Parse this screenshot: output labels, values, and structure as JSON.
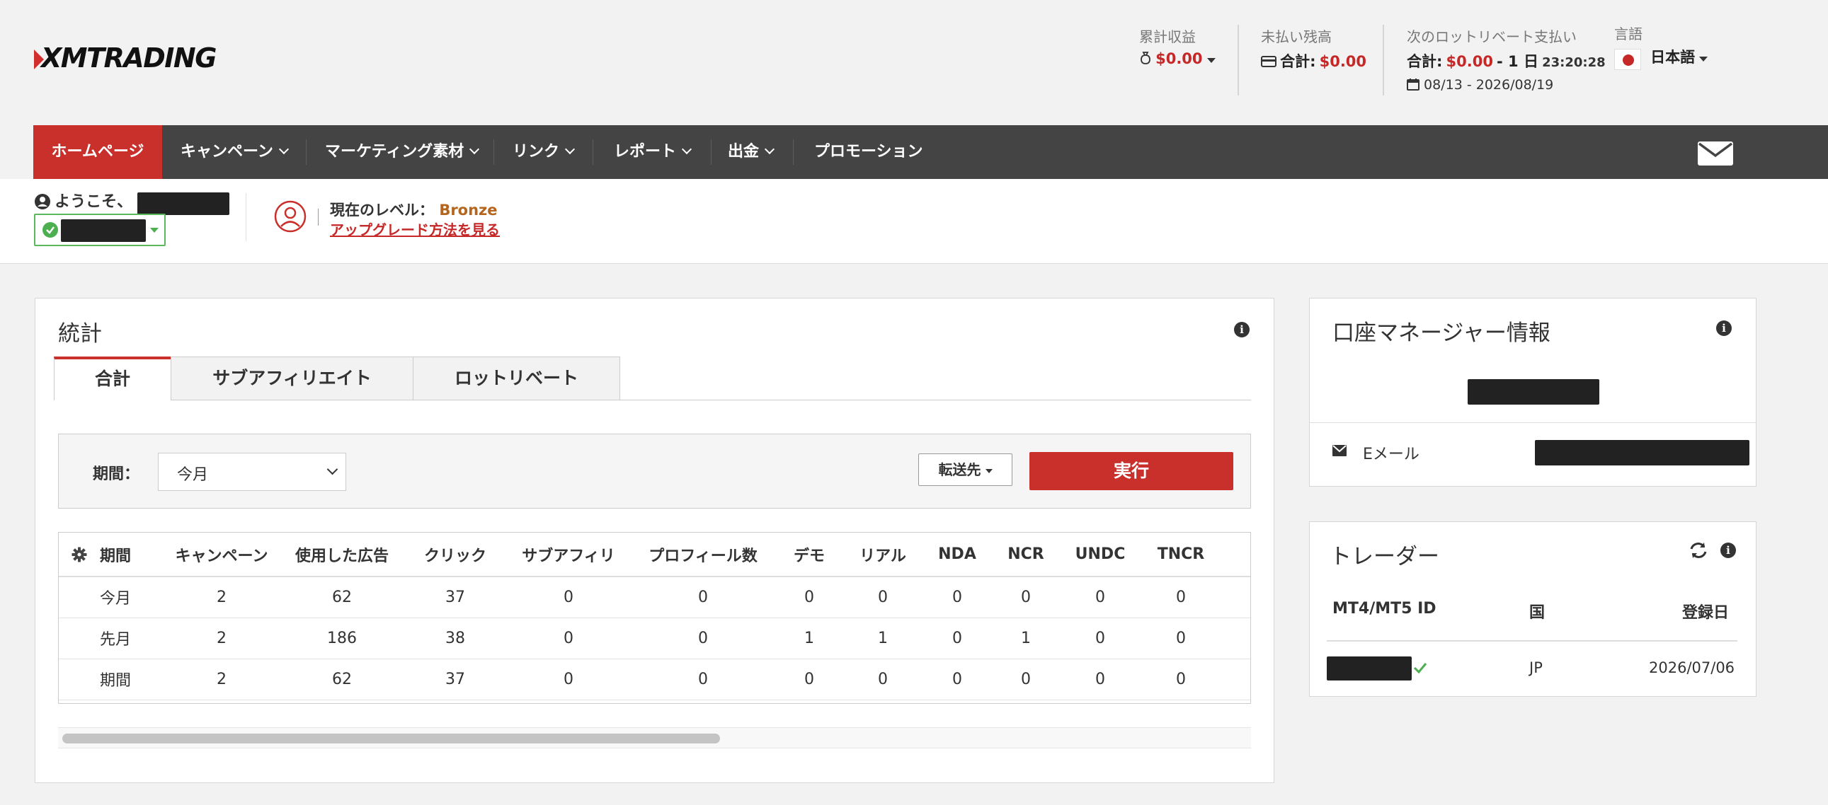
{
  "brand": {
    "logo": "XMTRADING"
  },
  "header": {
    "cumulative": {
      "label": "累計収益",
      "value": "$0.00"
    },
    "unpaid": {
      "label": "未払い残高",
      "total_label": "合計:",
      "value": "$0.00"
    },
    "next_payment": {
      "label": "次のロットリベート支払い",
      "total_label": "合計:",
      "value": "$0.00",
      "countdown_days": "- 1 日",
      "countdown_time": "23:20:28",
      "date_range": "08/13 - 2026/08/19"
    },
    "language": {
      "label": "言語",
      "value": "日本語"
    }
  },
  "nav": {
    "items": [
      {
        "label": "ホームページ",
        "dropdown": false
      },
      {
        "label": "キャンペーン",
        "dropdown": true
      },
      {
        "label": "マーケティング素材",
        "dropdown": true
      },
      {
        "label": "リンク",
        "dropdown": true
      },
      {
        "label": "レポート",
        "dropdown": true
      },
      {
        "label": "出金",
        "dropdown": true
      },
      {
        "label": "プロモーション",
        "dropdown": false
      }
    ]
  },
  "welcome": {
    "greeting": "ようこそ、",
    "level_label": "現在のレベル：",
    "level_value": "Bronze",
    "upgrade_link": "アップグレード方法を見る"
  },
  "stats": {
    "title": "統計",
    "tabs": [
      "合計",
      "サブアフィリエイト",
      "ロットリベート"
    ],
    "filter": {
      "period_label": "期間：",
      "period_value": "今月",
      "forward_label": "転送先",
      "execute_label": "実行"
    },
    "columns": [
      "期間",
      "キャンペーン",
      "使用した広告",
      "クリック",
      "サブアフィリ",
      "プロフィール数",
      "デモ",
      "リアル",
      "NDA",
      "NCR",
      "UNDC",
      "TNCR"
    ],
    "rows": [
      [
        "今月",
        "2",
        "62",
        "37",
        "0",
        "0",
        "0",
        "0",
        "0",
        "0",
        "0",
        "0"
      ],
      [
        "先月",
        "2",
        "186",
        "38",
        "0",
        "0",
        "1",
        "1",
        "0",
        "1",
        "0",
        "0"
      ],
      [
        "期間",
        "2",
        "62",
        "37",
        "0",
        "0",
        "0",
        "0",
        "0",
        "0",
        "0",
        "0"
      ]
    ]
  },
  "manager": {
    "title": "口座マネージャー情報",
    "email_label": "Eメール"
  },
  "traders": {
    "title": "トレーダー",
    "columns": [
      "MT4/MT5 ID",
      "国",
      "登録日"
    ],
    "rows": [
      {
        "country": "JP",
        "date": "2026/07/06"
      }
    ]
  },
  "colors": {
    "accent": "#c9302c",
    "nav_bg": "#444444",
    "success": "#4caf50"
  }
}
